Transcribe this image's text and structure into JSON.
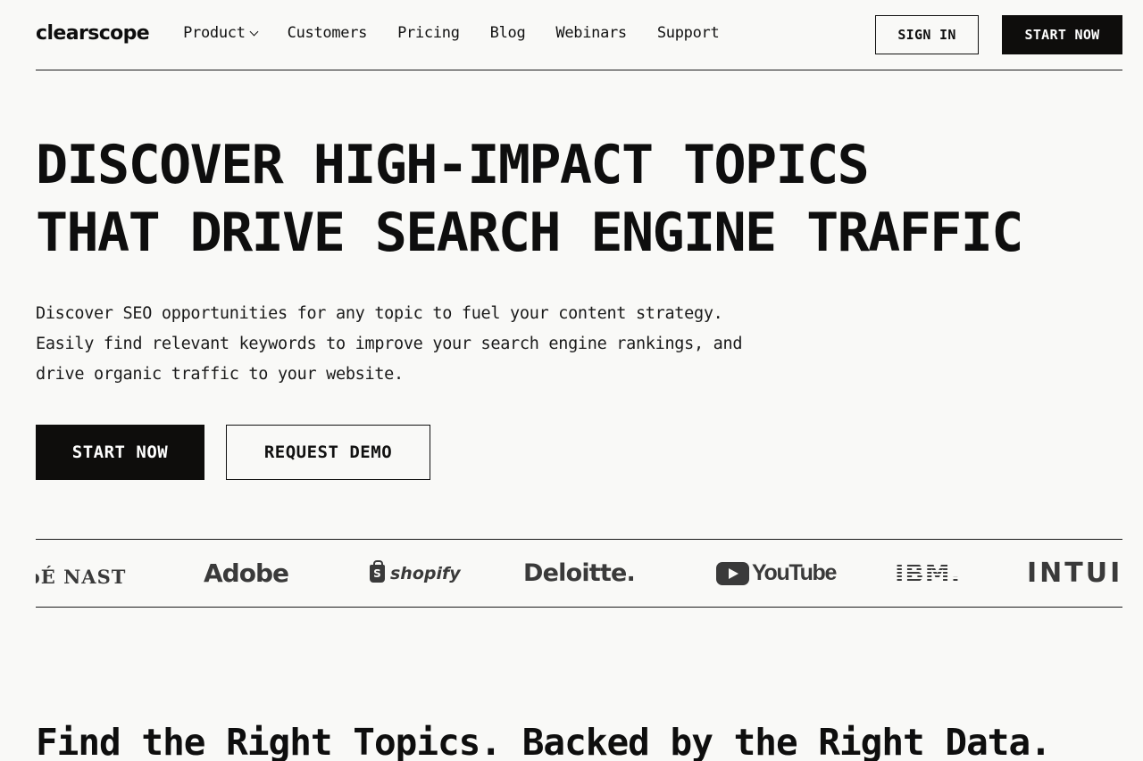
{
  "header": {
    "logo": "clearscope",
    "nav": [
      {
        "label": "Product",
        "has_dropdown": true
      },
      {
        "label": "Customers"
      },
      {
        "label": "Pricing"
      },
      {
        "label": "Blog"
      },
      {
        "label": "Webinars"
      },
      {
        "label": "Support"
      }
    ],
    "sign_in_label": "SIGN IN",
    "start_now_label": "START NOW"
  },
  "hero": {
    "title_lines": [
      "DISCOVER HIGH-IMPACT TOPICS",
      "THAT DRIVE SEARCH ENGINE TRAFFIC"
    ],
    "subtitle_lines": [
      "Discover SEO opportunities for any topic to fuel your content strategy.",
      "Easily find relevant keywords to improve your search engine rankings, and",
      "drive organic traffic to your website."
    ],
    "primary_cta": "START NOW",
    "secondary_cta": "REQUEST DEMO"
  },
  "logos": [
    "CONDÉ NAST",
    "Adobe",
    "shopify",
    "Deloitte.",
    "YouTube",
    "IBM",
    "INTUIT"
  ],
  "logos_visible_text": {
    "condenast": "ɔÉ NAST",
    "adobe": "Adobe",
    "shopify": "shopify",
    "deloitte": "Deloitte.",
    "youtube": "YouTube",
    "ibm": "IBM.",
    "intuit": "INTUIT"
  },
  "section": {
    "title": "Find the Right Topics. Backed by the Right Data."
  },
  "colors": {
    "background": "#f9f9f7",
    "text": "#0e0e0e",
    "button_dark": "#0e0d0c",
    "logo_gray": "#3a3a3a"
  }
}
